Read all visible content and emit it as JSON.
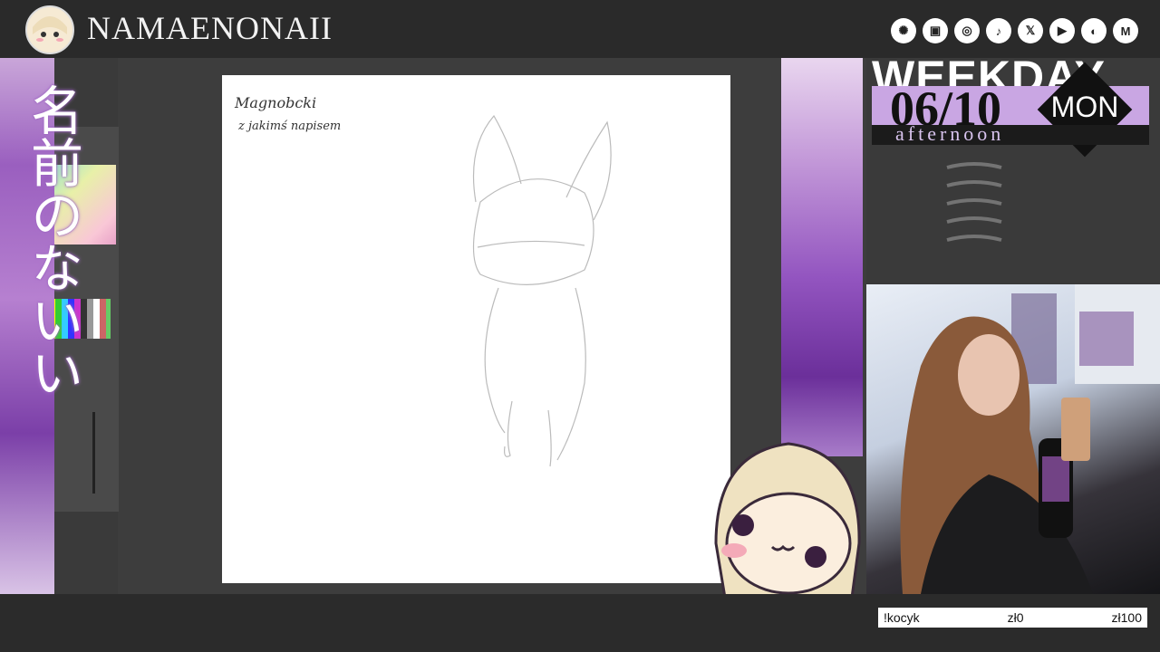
{
  "channel": {
    "name": "NAMAENONAII"
  },
  "social": [
    {
      "icon": "linktree-icon",
      "glyph": "✺"
    },
    {
      "icon": "twitch-icon",
      "glyph": "▣"
    },
    {
      "icon": "instagram-icon",
      "glyph": "◎"
    },
    {
      "icon": "tiktok-icon",
      "glyph": "♪"
    },
    {
      "icon": "x-icon",
      "glyph": "𝕏"
    },
    {
      "icon": "youtube-icon",
      "glyph": "▶"
    },
    {
      "icon": "discord-icon",
      "glyph": "◐"
    },
    {
      "icon": "mail-icon",
      "glyph": "M"
    }
  ],
  "side_text": "名前のないい",
  "schedule": {
    "weekday_word": "WEEKDAY",
    "date": "06/10",
    "day": "MON",
    "period": "afternoon"
  },
  "sketch_note": {
    "line1": "Magnobcki",
    "line2": "z jakimś napisem"
  },
  "goal": {
    "command": "!kocyk",
    "current": "zł0",
    "target": "zł100"
  },
  "colors": {
    "accent": "#c9a6e3",
    "bg": "#2b2b2b",
    "lilac": "#9a5fbf"
  }
}
